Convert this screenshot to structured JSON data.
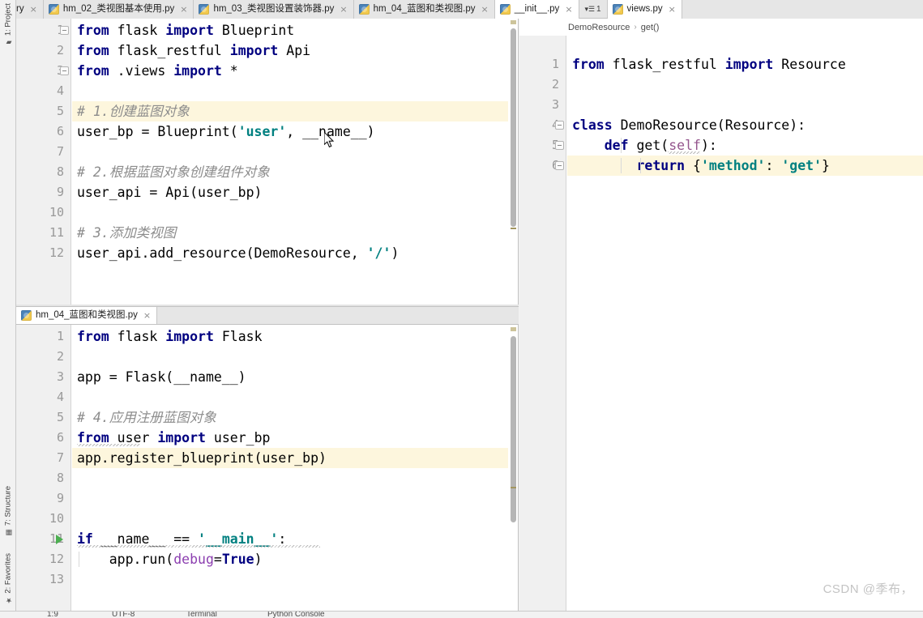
{
  "window": {
    "ide": "PyCharm",
    "watermark": "CSDN @季布，"
  },
  "toolwindows": {
    "top": [
      {
        "label": "1: Project",
        "icon": "project-folder-icon"
      }
    ],
    "bottom": [
      {
        "label": "7: Structure",
        "icon": "structure-icon"
      },
      {
        "label": "2: Favorites",
        "icon": "star-icon"
      }
    ]
  },
  "tabbar": {
    "tabs": [
      {
        "label": "ry",
        "active": false,
        "clipped": true,
        "icon": "python-file-icon",
        "close": "×"
      },
      {
        "label": "hm_02_类视图基本使用.py",
        "active": false,
        "clipped": false,
        "icon": "python-file-icon",
        "close": "×"
      },
      {
        "label": "hm_03_类视图设置装饰器.py",
        "active": false,
        "clipped": false,
        "icon": "python-file-icon",
        "close": "×"
      },
      {
        "label": "hm_04_蓝图和类视图.py",
        "active": false,
        "clipped": false,
        "icon": "python-file-icon",
        "close": "×"
      },
      {
        "label": "__init__.py",
        "active": true,
        "clipped": false,
        "icon": "python-file-icon",
        "close": "×"
      }
    ],
    "more_button": {
      "label": "1",
      "icon": "tab-list-icon"
    },
    "right_tabs": [
      {
        "label": "views.py",
        "active": true,
        "clipped": false,
        "icon": "python-file-icon",
        "close": "×"
      }
    ]
  },
  "panes": {
    "left_top": {
      "file": "__init__.py",
      "highlight_line": 5,
      "cursor_line": 6,
      "lines": [
        {
          "n": 1,
          "tokens": [
            {
              "t": "from",
              "c": "kw"
            },
            {
              "t": " flask ",
              "c": "plain"
            },
            {
              "t": "import",
              "c": "kw"
            },
            {
              "t": " Blueprint",
              "c": "plain"
            }
          ]
        },
        {
          "n": 2,
          "tokens": [
            {
              "t": "from",
              "c": "kw"
            },
            {
              "t": " flask_restful ",
              "c": "plain"
            },
            {
              "t": "import",
              "c": "kw"
            },
            {
              "t": " Api",
              "c": "plain"
            }
          ]
        },
        {
          "n": 3,
          "tokens": [
            {
              "t": "from",
              "c": "kw"
            },
            {
              "t": " .views ",
              "c": "plain"
            },
            {
              "t": "import",
              "c": "kw"
            },
            {
              "t": " *",
              "c": "plain"
            }
          ]
        },
        {
          "n": 4,
          "tokens": []
        },
        {
          "n": 5,
          "tokens": [
            {
              "t": "# 1.创建蓝图对象",
              "c": "cmt"
            }
          ]
        },
        {
          "n": 6,
          "tokens": [
            {
              "t": "user_bp = Blueprint(",
              "c": "plain"
            },
            {
              "t": "'user'",
              "c": "str"
            },
            {
              "t": ", __name__)",
              "c": "plain"
            }
          ]
        },
        {
          "n": 7,
          "tokens": []
        },
        {
          "n": 8,
          "tokens": [
            {
              "t": "# 2.根据蓝图对象创建组件对象",
              "c": "cmt"
            }
          ]
        },
        {
          "n": 9,
          "tokens": [
            {
              "t": "user_api = Api(user_bp)",
              "c": "plain"
            }
          ]
        },
        {
          "n": 10,
          "tokens": []
        },
        {
          "n": 11,
          "tokens": [
            {
              "t": "# 3.添加类视图",
              "c": "cmt"
            }
          ]
        },
        {
          "n": 12,
          "tokens": [
            {
              "t": "user_api.add_resource(DemoResource, ",
              "c": "plain"
            },
            {
              "t": "'/'",
              "c": "str"
            },
            {
              "t": ")",
              "c": "plain"
            }
          ]
        }
      ]
    },
    "left_bottom": {
      "file": "hm_04_蓝图和类视图.py",
      "tab_label": "hm_04_蓝图和类视图.py",
      "tab_close": "×",
      "highlight_line": 7,
      "run_marker_line": 11,
      "lines": [
        {
          "n": 1,
          "tokens": [
            {
              "t": "from",
              "c": "kw"
            },
            {
              "t": " flask ",
              "c": "plain"
            },
            {
              "t": "import",
              "c": "kw"
            },
            {
              "t": " Flask",
              "c": "plain"
            }
          ]
        },
        {
          "n": 2,
          "tokens": []
        },
        {
          "n": 3,
          "tokens": [
            {
              "t": "app = Flask(__name__)",
              "c": "plain"
            }
          ]
        },
        {
          "n": 4,
          "tokens": []
        },
        {
          "n": 5,
          "tokens": [
            {
              "t": "# 4.应用注册蓝图对象",
              "c": "cmt"
            }
          ]
        },
        {
          "n": 6,
          "tokens": [
            {
              "t": "from",
              "c": "kw"
            },
            {
              "t": " user ",
              "c": "plain"
            },
            {
              "t": "import",
              "c": "kw"
            },
            {
              "t": " user_bp",
              "c": "plain"
            }
          ]
        },
        {
          "n": 7,
          "tokens": [
            {
              "t": "app.register_blueprint(user_bp)",
              "c": "plain"
            }
          ]
        },
        {
          "n": 8,
          "tokens": []
        },
        {
          "n": 9,
          "tokens": []
        },
        {
          "n": 10,
          "tokens": []
        },
        {
          "n": 11,
          "tokens": [
            {
              "t": "if",
              "c": "kw"
            },
            {
              "t": " __name__ == ",
              "c": "plain"
            },
            {
              "t": "'__main__'",
              "c": "str"
            },
            {
              "t": ":",
              "c": "plain"
            }
          ]
        },
        {
          "n": 12,
          "tokens": [
            {
              "t": "    app.run(",
              "c": "plain"
            },
            {
              "t": "debug",
              "c": "kwp"
            },
            {
              "t": "=",
              "c": "plain"
            },
            {
              "t": "True",
              "c": "bool"
            },
            {
              "t": ")",
              "c": "plain"
            }
          ]
        },
        {
          "n": 13,
          "tokens": []
        }
      ]
    },
    "right": {
      "file": "views.py",
      "breadcrumb": [
        "DemoResource",
        "get()"
      ],
      "breadcrumb_sep": "›",
      "highlight_line": 6,
      "lines": [
        {
          "n": 1,
          "tokens": [
            {
              "t": "from",
              "c": "kw"
            },
            {
              "t": " flask_restful ",
              "c": "plain"
            },
            {
              "t": "import",
              "c": "kw"
            },
            {
              "t": " Resource",
              "c": "plain"
            }
          ]
        },
        {
          "n": 2,
          "tokens": []
        },
        {
          "n": 3,
          "tokens": []
        },
        {
          "n": 4,
          "tokens": [
            {
              "t": "class",
              "c": "kw"
            },
            {
              "t": " DemoResource(Resource):",
              "c": "plain"
            }
          ]
        },
        {
          "n": 5,
          "tokens": [
            {
              "t": "    ",
              "c": "plain"
            },
            {
              "t": "def",
              "c": "kw"
            },
            {
              "t": " get(",
              "c": "plain"
            },
            {
              "t": "self",
              "c": "slf"
            },
            {
              "t": "):",
              "c": "plain"
            }
          ]
        },
        {
          "n": 6,
          "tokens": [
            {
              "t": "        ",
              "c": "plain"
            },
            {
              "t": "return",
              "c": "kw"
            },
            {
              "t": " {",
              "c": "plain"
            },
            {
              "t": "'method'",
              "c": "str"
            },
            {
              "t": ": ",
              "c": "plain"
            },
            {
              "t": "'get'",
              "c": "str"
            },
            {
              "t": "}",
              "c": "plain"
            }
          ]
        }
      ]
    }
  },
  "statusbar": {
    "items": [
      "1:9",
      "UTF-8",
      "Terminal",
      "Python Console"
    ]
  },
  "colors": {
    "keyword": "#000080",
    "string": "#008080",
    "comment": "#8c8c8c",
    "self": "#94558d",
    "kwarg": "#8c3fb0",
    "line_highlight": "#fdf6dd",
    "gutter_bg": "#f0f0f0",
    "tab_active_bg": "#ffffff",
    "tab_bg": "#e6e6e6",
    "run_arrow": "#4caf50"
  }
}
